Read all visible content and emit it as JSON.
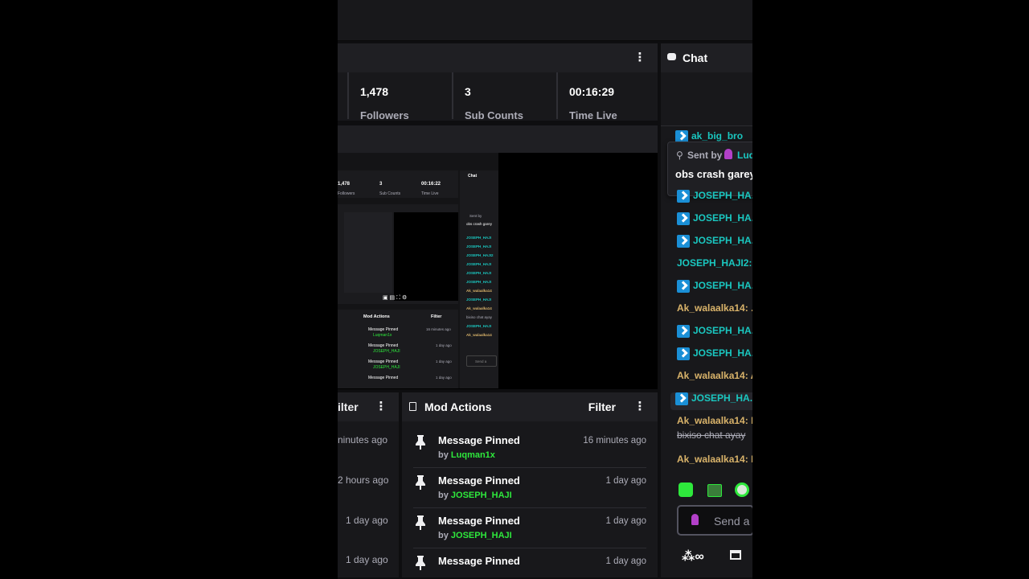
{
  "stats": [
    {
      "value": "1,478",
      "label": "Followers"
    },
    {
      "value": "3",
      "label": "Sub Counts"
    },
    {
      "value": "00:16:29",
      "label": "Time Live"
    }
  ],
  "chat": {
    "title": "Chat",
    "pinned": {
      "sent_by": "Sent by",
      "user": "Luq",
      "message": "obs crash garey"
    },
    "top_partial": "ak_big_bro",
    "messages": [
      {
        "kind": "mod",
        "text": "JOSEPH_HA."
      },
      {
        "kind": "mod",
        "text": "JOSEPH_HA."
      },
      {
        "kind": "mod",
        "text": "JOSEPH_HA."
      },
      {
        "kind": "plain-teal",
        "text": "JOSEPH_HAJI2:"
      },
      {
        "kind": "mod",
        "text": "JOSEPH_HA."
      },
      {
        "kind": "plain-gold",
        "text": "Ak_walaalka14: ."
      },
      {
        "kind": "mod",
        "text": "JOSEPH_HA."
      },
      {
        "kind": "mod",
        "text": "JOSEPH_HA."
      },
      {
        "kind": "plain-gold",
        "text": "Ak_walaalka14: A"
      },
      {
        "kind": "mod",
        "text": "JOSEPH_HA."
      },
      {
        "kind": "plain-gold",
        "text": "Ak_walaalka14: I"
      },
      {
        "kind": "strike",
        "text": "bixiso chat ayay"
      },
      {
        "kind": "plain-gold",
        "text": "Ak_walaalka14: I"
      }
    ],
    "input_placeholder": "Send a r",
    "emote_icons": [
      "green-emote-icon",
      "frog-emote-icon",
      "robot-emote-icon"
    ],
    "bottom_icons": [
      "points-icon",
      "store-icon"
    ]
  },
  "left_panel": {
    "filter_label": "ilter",
    "times": [
      "ninutes ago",
      "2 hours ago",
      "1 day ago",
      "1 day ago"
    ]
  },
  "mod_actions": {
    "title": "Mod Actions",
    "filter_label": "Filter",
    "items": [
      {
        "title": "Message Pinned",
        "by": "by",
        "user": "Luqman1x",
        "time": "16 minutes ago"
      },
      {
        "title": "Message Pinned",
        "by": "by",
        "user": "JOSEPH_HAJI",
        "time": "1 day ago"
      },
      {
        "title": "Message Pinned",
        "by": "by",
        "user": "JOSEPH_HAJI",
        "time": "1 day ago"
      },
      {
        "title": "Message Pinned",
        "by": "",
        "user": "",
        "time": "1 day ago"
      }
    ]
  },
  "mini": {
    "stats": [
      {
        "value": "1,478",
        "label": "Followers"
      },
      {
        "value": "3",
        "label": "Sub Counts"
      },
      {
        "value": "00:16:22",
        "label": "Time Live"
      }
    ],
    "chat_title": "Chat",
    "pinned_sent": "Sent by",
    "pinned_msg": "obs crash garey",
    "mod_title": "Mod Actions",
    "mod_filter": "Filter",
    "mod_items": [
      {
        "title": "Message Pinned",
        "user": "Luqman1x",
        "time": "16 minutes ago"
      },
      {
        "title": "Message Pinned",
        "user": "JOSEPH_HAJI",
        "time": "1 day ago"
      },
      {
        "title": "Message Pinned",
        "user": "JOSEPH_HAJI",
        "time": "1 day ago"
      },
      {
        "title": "Message Pinned",
        "user": "",
        "time": "1 day ago"
      }
    ],
    "chat_lines": [
      "JOSEPH_HAJI",
      "JOSEPH_HAJI",
      "JOSEPH_HAJI2",
      "JOSEPH_HAJI",
      "JOSEPH_HAJI",
      "JOSEPH_HAJI",
      "Ak_walaalka14",
      "JOSEPH_HAJI",
      "Ak_walaalka14",
      "bixiso chat ayay",
      "JOSEPH_HAJI",
      "Ak_walaalka14"
    ],
    "send": "Send a"
  },
  "colors": {
    "accent_green": "#2ee83c",
    "mod_blue": "#1a8fd6",
    "teal_name": "#1ac7c0",
    "gold_name": "#d9b36a"
  }
}
